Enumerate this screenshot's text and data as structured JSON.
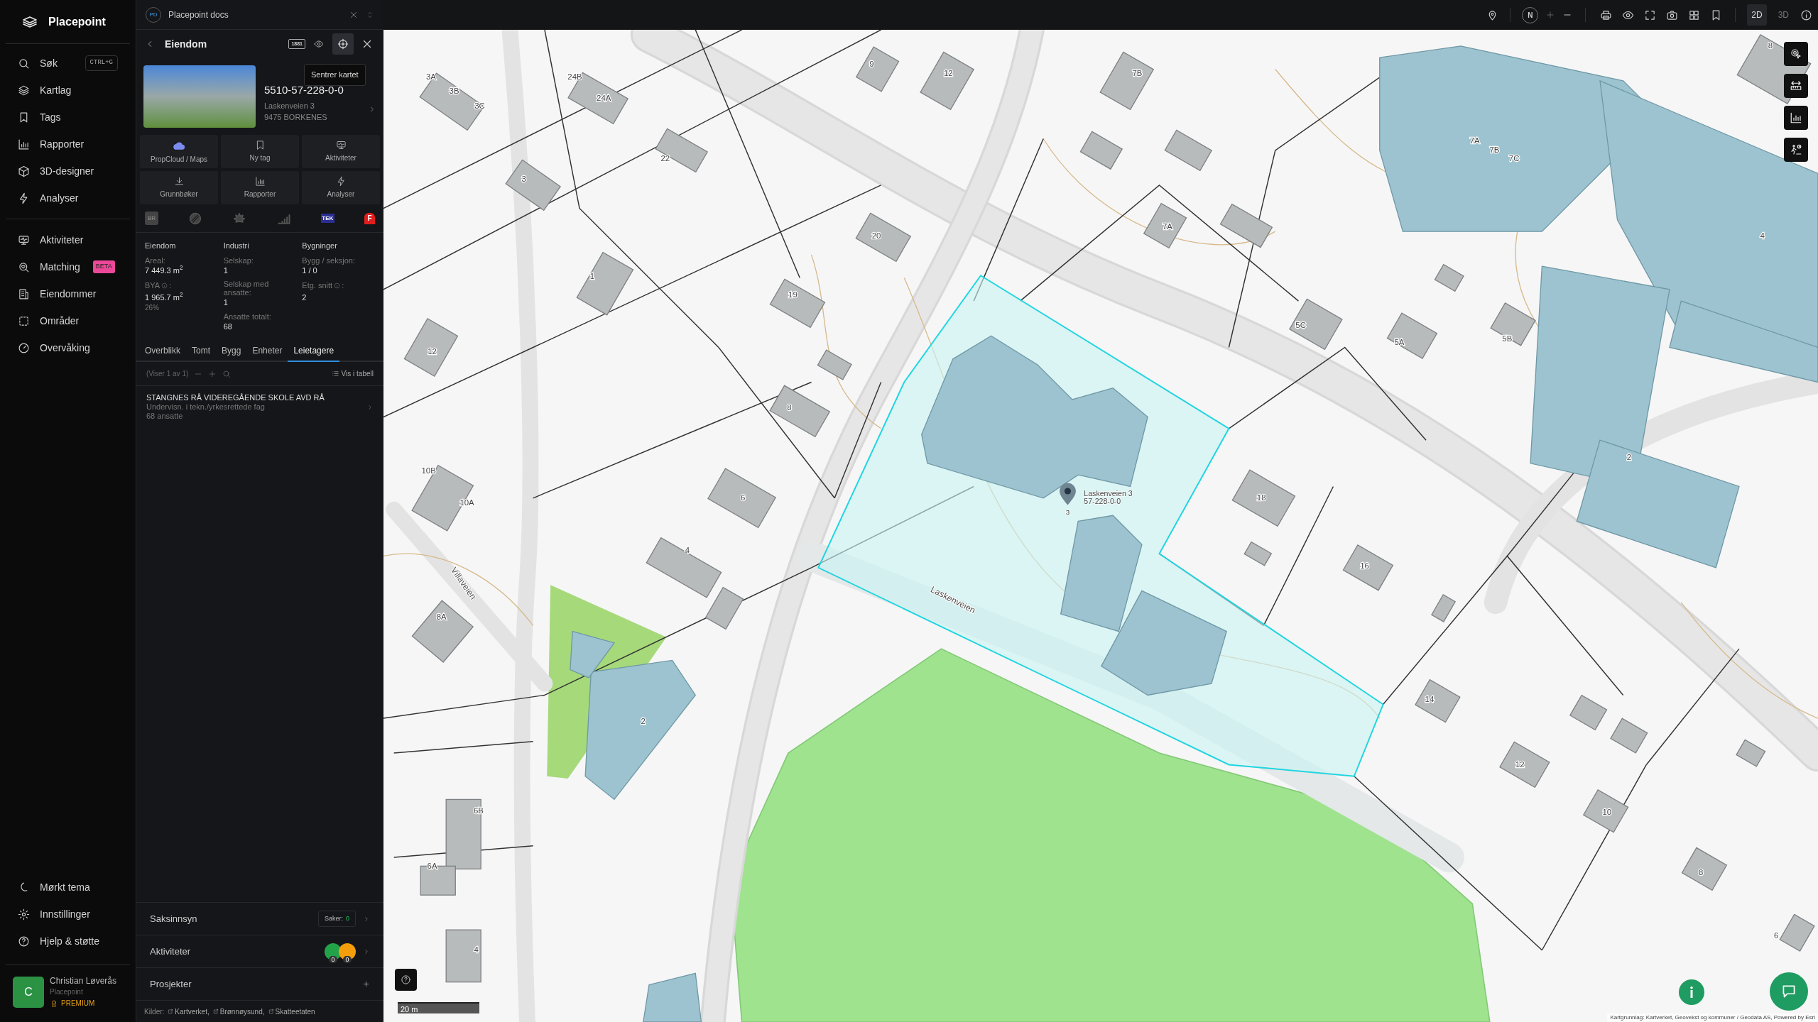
{
  "app": {
    "name": "Placepoint"
  },
  "nav": {
    "main": [
      {
        "label": "Søk",
        "shortcut": "CTRL+G"
      },
      {
        "label": "Kartlag"
      },
      {
        "label": "Tags"
      },
      {
        "label": "Rapporter"
      },
      {
        "label": "3D-designer"
      },
      {
        "label": "Analyser"
      }
    ],
    "secondary": [
      {
        "label": "Aktiviteter"
      },
      {
        "label": "Matching",
        "badge": "BETA"
      },
      {
        "label": "Eiendommer"
      },
      {
        "label": "Områder"
      },
      {
        "label": "Overvåking"
      }
    ],
    "footer": [
      {
        "label": "Mørkt tema"
      },
      {
        "label": "Innstillinger"
      },
      {
        "label": "Hjelp & støtte"
      }
    ],
    "user": {
      "initial": "C",
      "name": "Christian Løverås",
      "organization": "Placepoint",
      "plan": "PREMIUM"
    }
  },
  "panel": {
    "workspace": {
      "badge": "PD",
      "title": "Placepoint docs"
    },
    "header": {
      "title": "Eiendom",
      "logo_text": "1881",
      "tooltip": "Sentrer kartet"
    },
    "property": {
      "id": "5510-57-228-0-0",
      "address": "Laskenveien 3",
      "postal": "9475 BORKENES"
    },
    "actions": [
      "PropCloud / Maps",
      "Ny tag",
      "Aktiviteter",
      "Grunnbøker",
      "Rapporter",
      "Analyser"
    ],
    "sources": [
      {
        "kind": "text",
        "label": "BR"
      },
      {
        "kind": "icon"
      },
      {
        "kind": "icon"
      },
      {
        "kind": "icon"
      },
      {
        "kind": "text",
        "label": "TEK"
      },
      {
        "kind": "text",
        "label": "F"
      }
    ],
    "stats": [
      {
        "title": "Eiendom",
        "fields": [
          {
            "label": "Areal:",
            "value": "7 449.3 m$^{2}$"
          },
          {
            "label": "BYA",
            "info": true,
            "label_end": ":",
            "value": "1 965.7 m$^{2}$",
            "note": "26%"
          }
        ]
      },
      {
        "title": "Industri",
        "fields": [
          {
            "label": "Selskap:",
            "value": "1"
          },
          {
            "label": "Selskap med ansatte:",
            "value": "1"
          },
          {
            "label": "Ansatte totalt:",
            "value": "68"
          }
        ]
      },
      {
        "title": "Bygninger",
        "fields": [
          {
            "label": "Bygg / seksjon:",
            "value": "1 / 0"
          },
          {
            "label": "Etg. snitt",
            "info": true,
            "label_end": ":",
            "value": "2"
          }
        ]
      }
    ],
    "tabs": [
      {
        "label": "Overblikk",
        "selected": false
      },
      {
        "label": "Tomt",
        "selected": false
      },
      {
        "label": "Bygg",
        "selected": false
      },
      {
        "label": "Enheter",
        "selected": false
      },
      {
        "label": "Leietagere",
        "selected": true
      }
    ],
    "list_toolbar": {
      "count": "(Viser 1 av 1)",
      "table_link": "Vis i tabell"
    },
    "tenants": [
      {
        "name": "STANGNES RÅ VIDEREGÅENDE SKOLE AVD RÅ",
        "industry": "Undervisn. i tekn./yrkesrettede fag",
        "employees": "68 ansatte"
      }
    ],
    "sections": [
      {
        "kind": "cases",
        "title": "Saksinnsyn",
        "badge_label": "Saker:",
        "badge_value": "0"
      },
      {
        "kind": "activities",
        "title": "Aktiviteter",
        "counters": [
          {
            "color": "#22a34a",
            "count": "0"
          },
          {
            "color": "#f59e0b",
            "count": "0"
          }
        ]
      },
      {
        "kind": "add",
        "title": "Prosjekter"
      }
    ],
    "sources_footer": {
      "label": "Kilder:",
      "links": [
        "Kartverket,",
        "Brønnøysund,",
        "Skatteetaten"
      ]
    }
  },
  "map": {
    "compass": "N",
    "view_modes": [
      {
        "label": "2D",
        "selected": true
      },
      {
        "label": "3D",
        "selected": false
      }
    ],
    "house_numbers": [
      "3A",
      "3B",
      "3C",
      "24B",
      "24A",
      "9",
      "12",
      "7B",
      "22",
      "3",
      "20",
      "7A",
      "1",
      "19",
      "12",
      "8",
      "5C",
      "5A",
      "5B",
      "7A",
      "7B",
      "7C",
      "4",
      "2",
      "10B",
      "10A",
      "6",
      "18",
      "16",
      "4",
      "8A",
      "2",
      "14",
      "12",
      "10",
      "8",
      "6",
      "6B",
      "6A",
      "4",
      "8"
    ],
    "streets": [
      "Laskenveien",
      "Villaveien"
    ],
    "marker": {
      "address": "Laskenveien 3",
      "id": "57-228-0-0",
      "number": "3"
    },
    "scale": "20 m",
    "attribution": "Kartgrunnlag: Kartverket, Geovekst og kommuner / Geodata AS, Powered by Esri"
  }
}
